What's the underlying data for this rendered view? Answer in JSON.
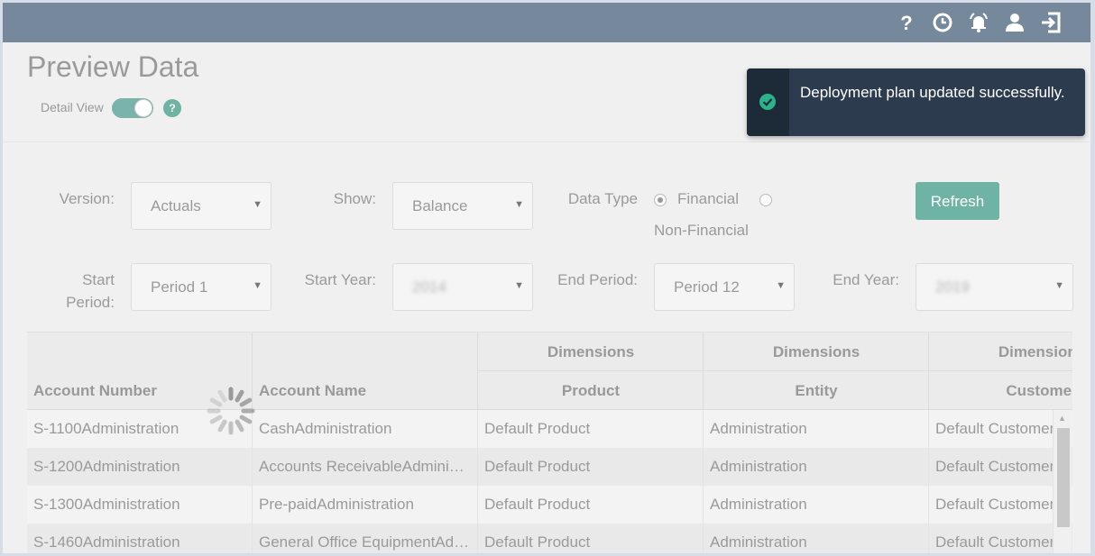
{
  "topbar": {
    "icons": [
      "help-icon",
      "clock-icon",
      "bell-icon",
      "user-icon",
      "logout-icon"
    ]
  },
  "page": {
    "title": "Preview Data",
    "detail_view_label": "Detail View",
    "help_glyph": "?"
  },
  "toast": {
    "message": "Deployment plan updated successfully.",
    "icon": "check-circle-icon"
  },
  "filters": {
    "version_label": "Version:",
    "version_value": "Actuals",
    "show_label": "Show:",
    "show_value": "Balance",
    "data_type_label": "Data Type",
    "financial_label": "Financial",
    "nonfinancial_label": "Non-Financial",
    "refresh_label": "Refresh",
    "start_period_label": "Start Period:",
    "start_period_value": "Period 1",
    "start_year_label": "Start Year:",
    "start_year_value": "2014",
    "end_period_label": "End Period:",
    "end_period_value": "Period 12",
    "end_year_label": "End Year:",
    "end_year_value": "2019",
    "caret": "▼"
  },
  "table": {
    "group_header": "Dimensions",
    "columns": [
      "Account Number",
      "Account Name",
      "Product",
      "Entity",
      "Customer"
    ],
    "rows": [
      [
        "S-1100Administration",
        "CashAdministration",
        "Default Product",
        "Administration",
        "Default Customer"
      ],
      [
        "S-1200Administration",
        "Accounts ReceivableAdmini…",
        "Default Product",
        "Administration",
        "Default Customer"
      ],
      [
        "S-1300Administration",
        "Pre-paidAdministration",
        "Default Product",
        "Administration",
        "Default Customer"
      ],
      [
        "S-1460Administration",
        "General Office EquipmentAd…",
        "Default Product",
        "Administration",
        "Default Customer"
      ]
    ]
  },
  "colors": {
    "topbar": "#76889c",
    "accent": "#6fb3a4",
    "toast_bg": "#2c3b4d"
  }
}
